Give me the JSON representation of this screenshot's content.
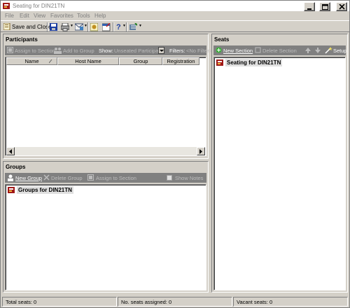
{
  "window": {
    "title": "Seating for DIN21TN"
  },
  "menu": [
    "File",
    "Edit",
    "View",
    "Favorites",
    "Tools",
    "Help"
  ],
  "toolbar": {
    "save_close_label": "Save and Close"
  },
  "participants": {
    "title": "Participants",
    "toolbar": {
      "assign_label": "Assign to Section",
      "add_group_label": "Add to Group",
      "show_label": "Show:",
      "show_value": "Unseated Participant",
      "filters_label": "Filters:",
      "filters_value": "<No Filter>"
    },
    "columns": [
      "Name",
      "Host Name",
      "Group",
      "Registration"
    ]
  },
  "groups": {
    "title": "Groups",
    "toolbar": {
      "new_label": "New Group",
      "delete_label": "Delete Group",
      "assign_label": "Assign to Section",
      "show_notes_label": "Show Notes"
    },
    "root_label": "Groups for DIN21TN"
  },
  "seats": {
    "title": "Seats",
    "toolbar": {
      "new_label": "New Section",
      "delete_label": "Delete Section",
      "setup_label": "Setup"
    },
    "root_label": "Seating for DIN21TN"
  },
  "status": {
    "total": "Total seats: 0",
    "assigned": "No. seats assigned: 0",
    "vacant": "Vacant seats: 0"
  },
  "colors": {
    "chrome": "#d4d0c8",
    "subbar": "#808080",
    "accent": "#0a246a"
  }
}
